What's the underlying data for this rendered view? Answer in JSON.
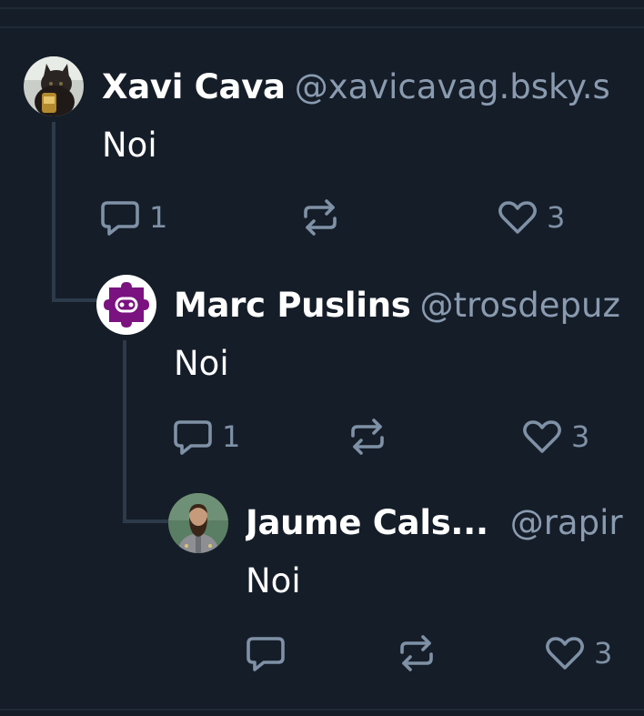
{
  "posts": [
    {
      "author_name": "Xavi Cava",
      "handle": "@xavicavag.bsky.s",
      "text": "Noi",
      "reply_count": "1",
      "like_count": "3"
    },
    {
      "author_name": "Marc Puslins",
      "handle": "@trosdepuz",
      "text": "Noi",
      "reply_count": "1",
      "like_count": "3"
    },
    {
      "author_name": "Jaume Cals...",
      "handle": "@rapir",
      "text": "Noi",
      "reply_count": "",
      "like_count": "3"
    }
  ],
  "colors": {
    "background": "#151d28",
    "thread_line": "#2c3a4a",
    "muted": "#7f91a6",
    "handle": "#8a9bb0"
  },
  "icons": [
    "reply-icon",
    "repost-icon",
    "like-icon"
  ]
}
